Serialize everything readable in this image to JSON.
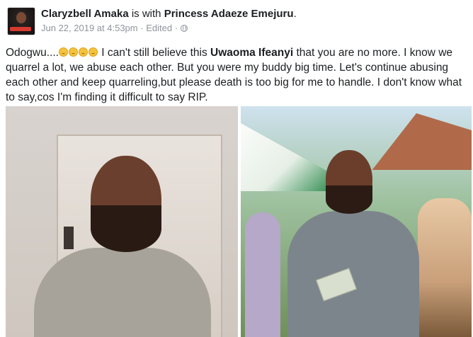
{
  "post": {
    "author": "Claryzbell Amaka",
    "with_text": "is with",
    "tagged": "Princess Adaeze Emejuru",
    "title_end": ".",
    "date": "Jun 22, 2019 at 4:53pm",
    "sep1": "·",
    "edited": "Edited",
    "sep2": "·",
    "privacy_icon": "globe-icon",
    "text_start": "Odogwu....",
    "emoji_icon": "crying-face-emoji",
    "text_mid": " I can't still believe this ",
    "mention": "Uwaoma Ifeanyi",
    "text_end": " that you are no more. I know we quarrel a lot, we abuse each other. But you were my buddy big time. Let's continue abusing each other and keep quarreling,but please death is too big for me to handle. I don't know what to say,cos I'm finding it difficult to say RIP."
  },
  "colors": {
    "meta": "#90949c",
    "text": "#1c1e21"
  }
}
